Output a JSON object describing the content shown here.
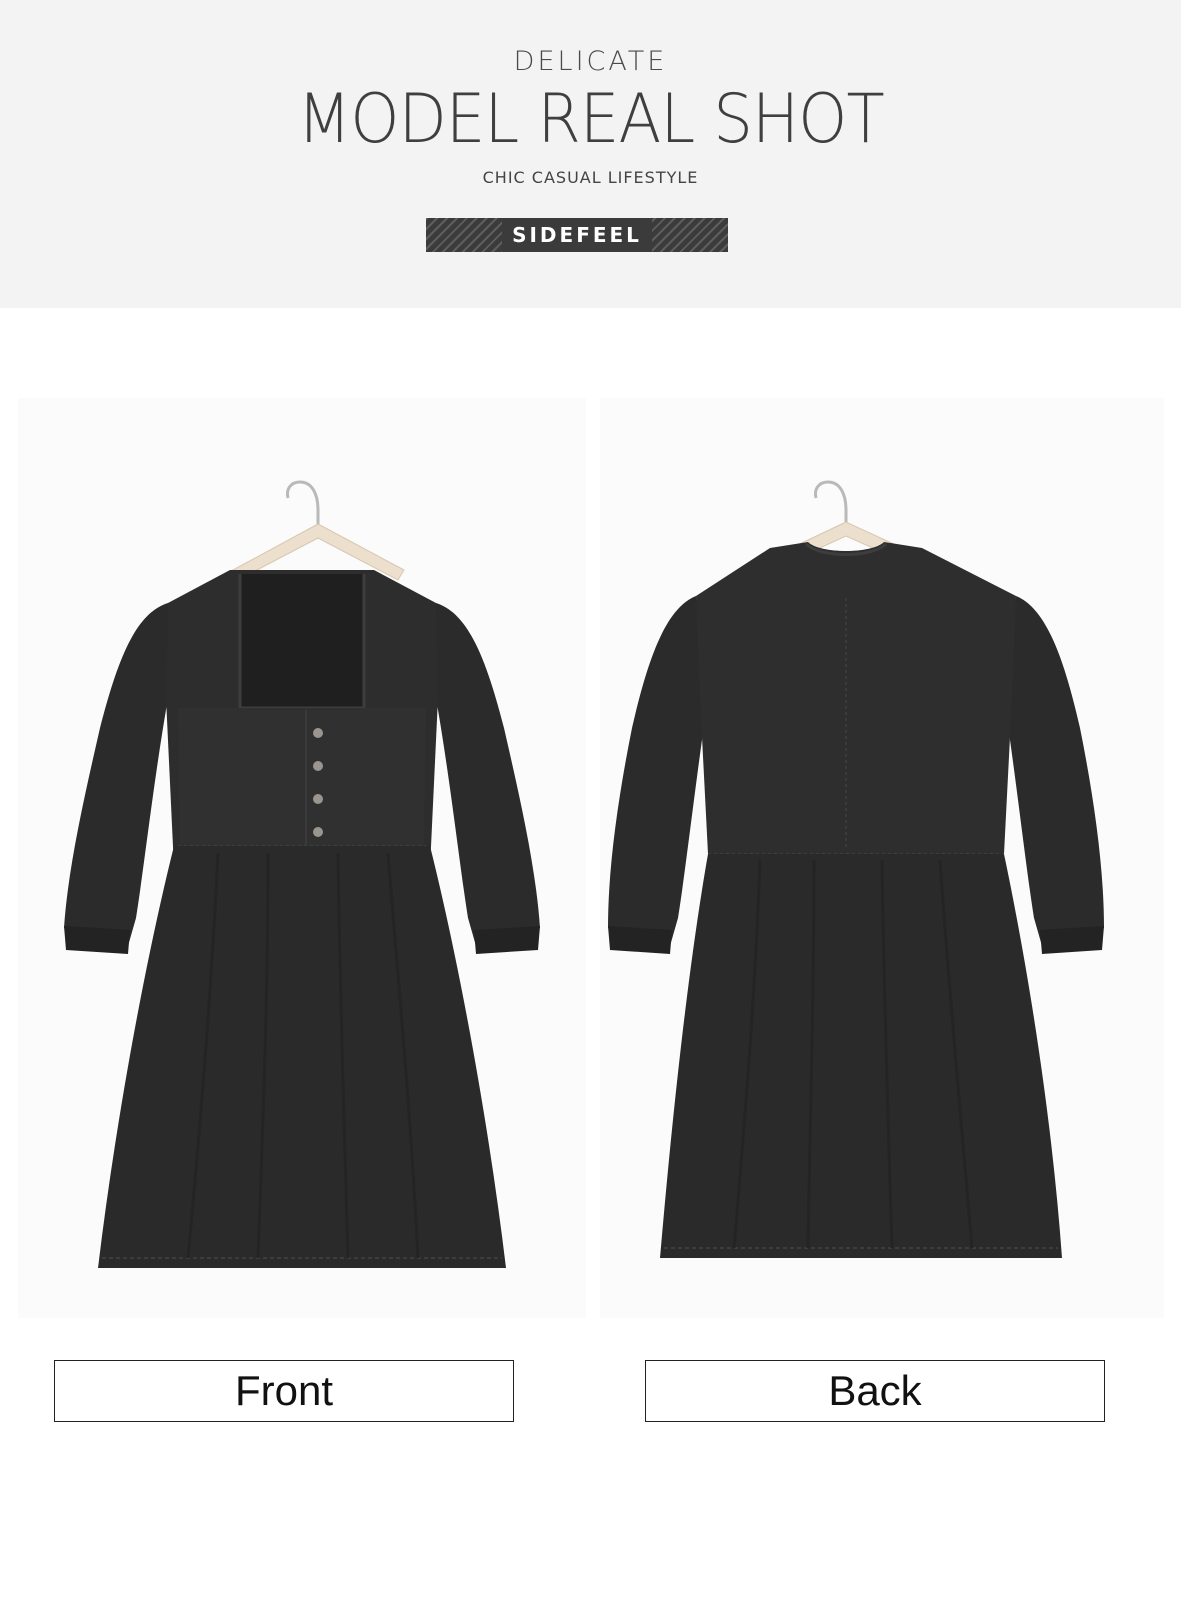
{
  "header": {
    "kicker": "DELICATE",
    "headline": "MODEL REAL SHOT",
    "tagline": "CHIC CASUAL LIFESTYLE",
    "brand": "SIDEFEEL"
  },
  "photos": {
    "front_label": "Front",
    "back_label": "Back"
  },
  "colors": {
    "header_bg": "#f3f3f3",
    "badge_bg": "#3b3b3b",
    "denim": "#2a2a2b",
    "hanger_wood": "#ecdfcd"
  }
}
